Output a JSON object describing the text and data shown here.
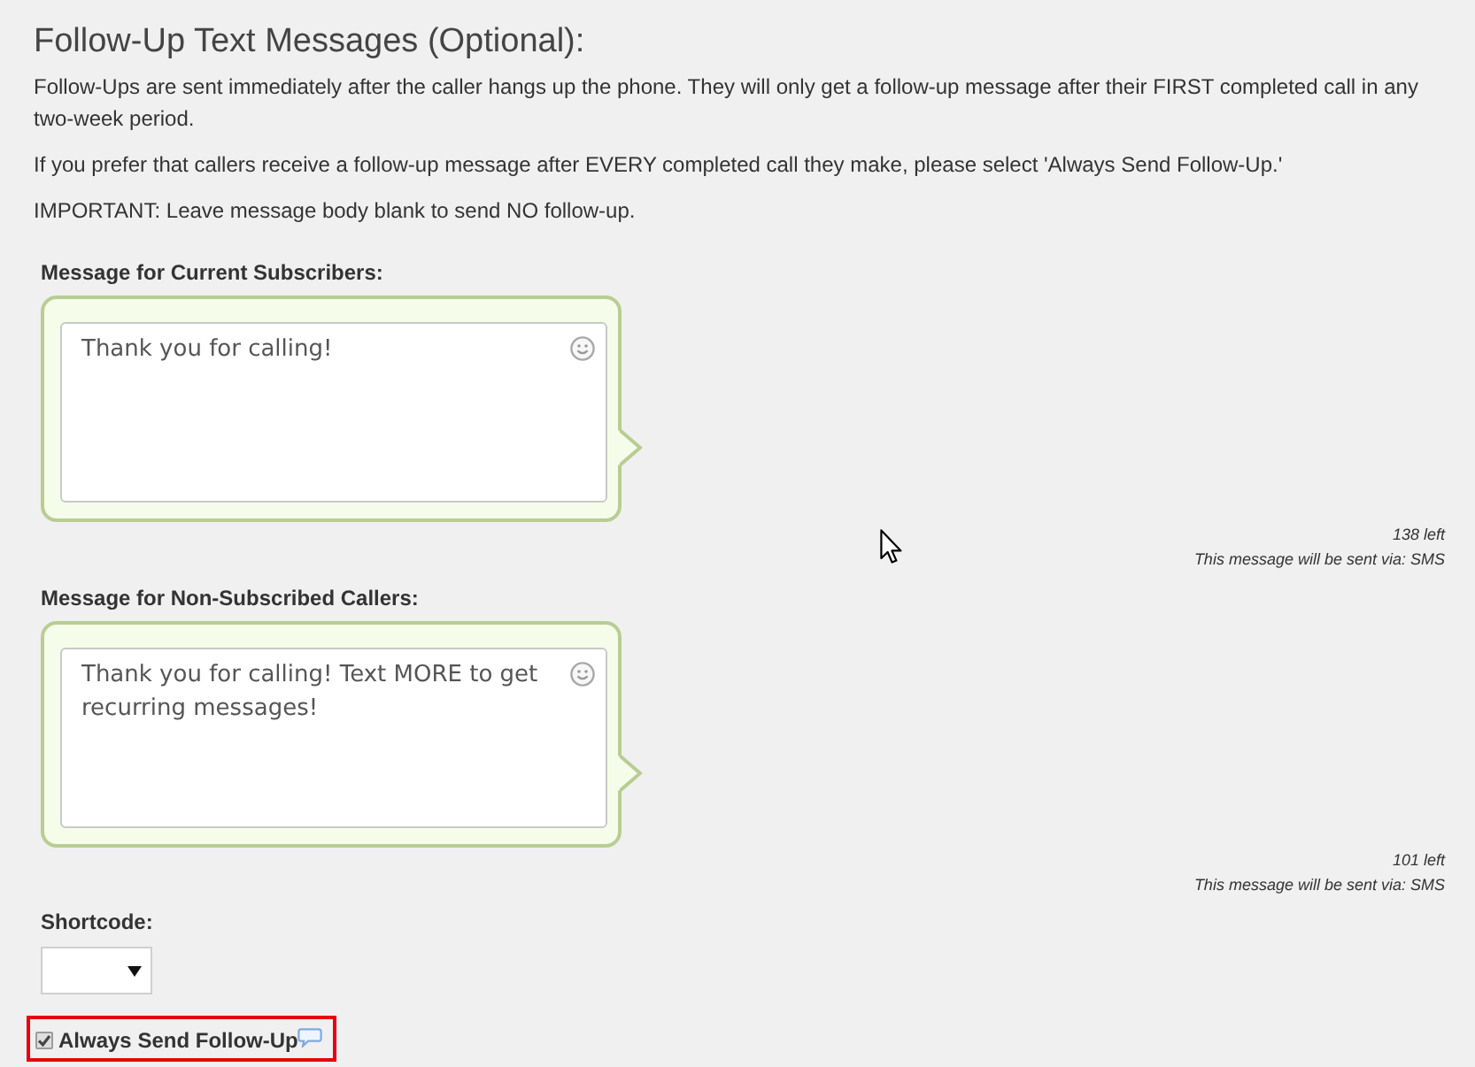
{
  "section": {
    "title": "Follow-Up Text Messages (Optional):",
    "paragraphs": [
      "Follow-Ups are sent immediately after the caller hangs up the phone. They will only get a follow-up message after their FIRST completed call in any two-week period.",
      "If you prefer that callers receive a follow-up message after EVERY completed call they make, please select 'Always Send Follow-Up.'",
      "IMPORTANT: Leave message body blank to send NO follow-up."
    ]
  },
  "messages": [
    {
      "label": "Message for Current Subscribers:",
      "value": "Thank you for calling!",
      "remaining": "138 left",
      "sent_via": "This message will be sent via: SMS"
    },
    {
      "label": "Message for Non-Subscribed Callers:",
      "value": "Thank you for calling! Text MORE to get recurring messages!",
      "remaining": "101 left",
      "sent_via": "This message will be sent via: SMS"
    }
  ],
  "shortcode": {
    "label": "Shortcode:"
  },
  "always_send": {
    "label": "Always Send Follow-Up",
    "checked": true,
    "highlighted": true
  }
}
